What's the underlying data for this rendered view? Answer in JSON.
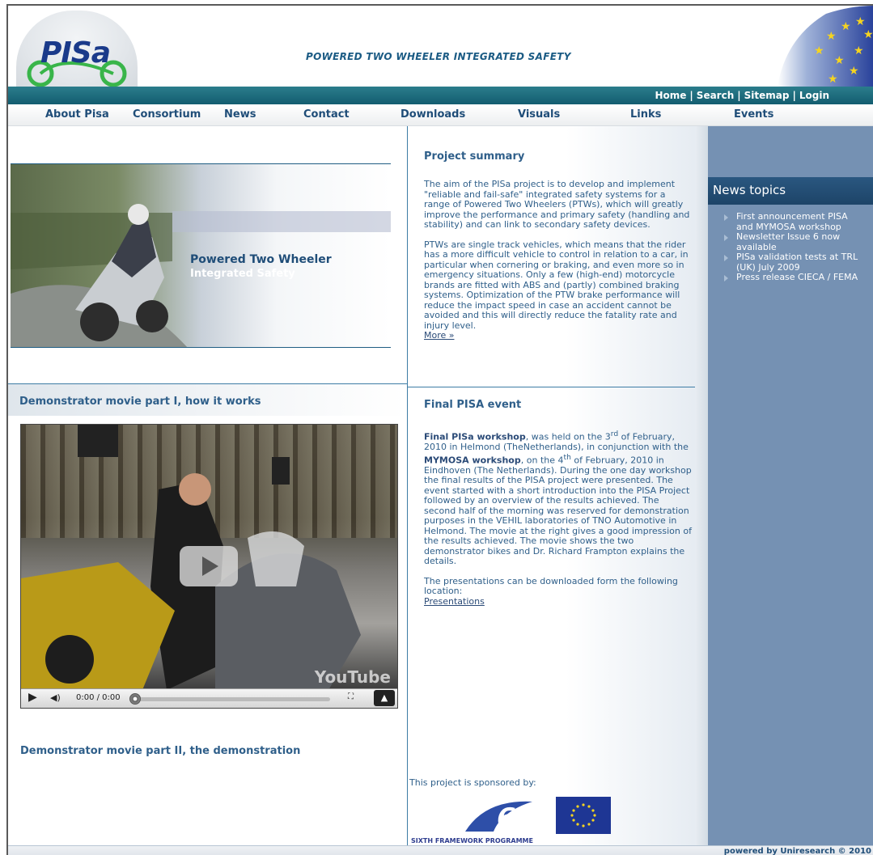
{
  "header": {
    "logo_text": "PISa",
    "tagline": "POWERED TWO WHEELER INTEGRATED SAFETY"
  },
  "utility_nav": [
    "Home",
    "Search",
    "Sitemap",
    "Login"
  ],
  "main_nav": [
    "About Pisa",
    "Consortium",
    "News",
    "Contact",
    "Downloads",
    "Visuals",
    "Links",
    "Events"
  ],
  "hero": {
    "title": "Powered Two Wheeler",
    "subtitle": "Integrated Safety"
  },
  "project_summary": {
    "heading": "Project summary",
    "paragraph1": "The aim of the PISa project is to develop and implement \"reliable and fail-safe\" integrated safety systems for a range of Powered Two Wheelers (PTWs), which will greatly improve the performance and primary safety (handling and stability) and can link to secondary safety devices.",
    "paragraph2": "PTWs are single track vehicles, which means that the rider has a more difficult vehicle to control in relation to a car, in particular when cornering or braking, and even more so in emergency situations. Only a few (high-end) motorcycle brands are fitted with ABS and (partly) combined braking systems. Optimization of the PTW brake performance will reduce the impact speed in case an accident cannot be avoided and this will directly reduce the fatality rate and injury level.",
    "more_link": "More »"
  },
  "final_event": {
    "heading": "Final PISA event",
    "workshop_bold": "Final PISa workshop",
    "text1": ", was held on the 3",
    "sup1": "rd",
    "text2": " of February, 2010 in Helmond (TheNetherlands), in conjunction with the ",
    "mymosa_bold": "MYMOSA workshop",
    "text3": ", on the 4",
    "sup2": "th",
    "text4": " of February, 2010 in Eindhoven (The Netherlands). During the one day workshop the final results of the PISA project were presented. The event started with a short introduction into the PISA Project followed by an overview of the results achieved. The second half of the morning was reserved for demonstration purposes in the VEHIL laboratories of TNO Automotive in Helmond. The movie at the right gives a good impression of the results achieved. The movie shows the two demonstrator bikes and Dr. Richard Frampton explains the details.",
    "downloads_text": "The presentations can be downloaded form the following location:",
    "presentations_link": "Presentations"
  },
  "demo_movie": {
    "heading1": "Demonstrator movie part I, how it works",
    "heading2": "Demonstrator movie part II, the demonstration",
    "time": "0:00 / 0:00",
    "watermark": "YouTube"
  },
  "news": {
    "heading": "News topics",
    "items": [
      "First announcement PISA\nand MYMOSA workshop",
      "Newsletter Issue 6 now\navailable",
      "PISa validation tests at TRL\n(UK) July 2009",
      "Press release CIECA / FEMA"
    ]
  },
  "sponsor": {
    "text": "This project is sponsored by:",
    "fp6_label": "SIXTH FRAMEWORK PROGRAMME"
  },
  "footer": {
    "text": "powered by Uniresearch © 2010"
  }
}
